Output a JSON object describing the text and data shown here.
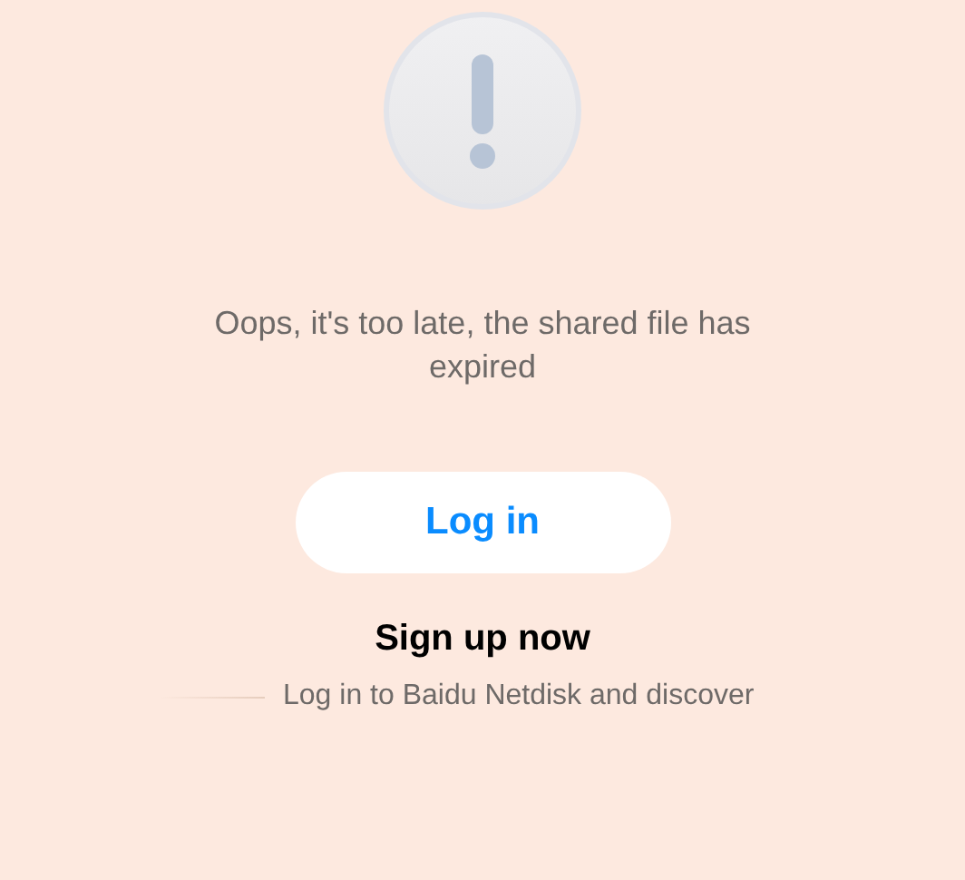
{
  "message": "Oops, it's too late, the shared file has expired",
  "login_button": "Log in",
  "signup_heading": "Sign up now",
  "signup_subtext": "Log in to Baidu Netdisk and discover"
}
